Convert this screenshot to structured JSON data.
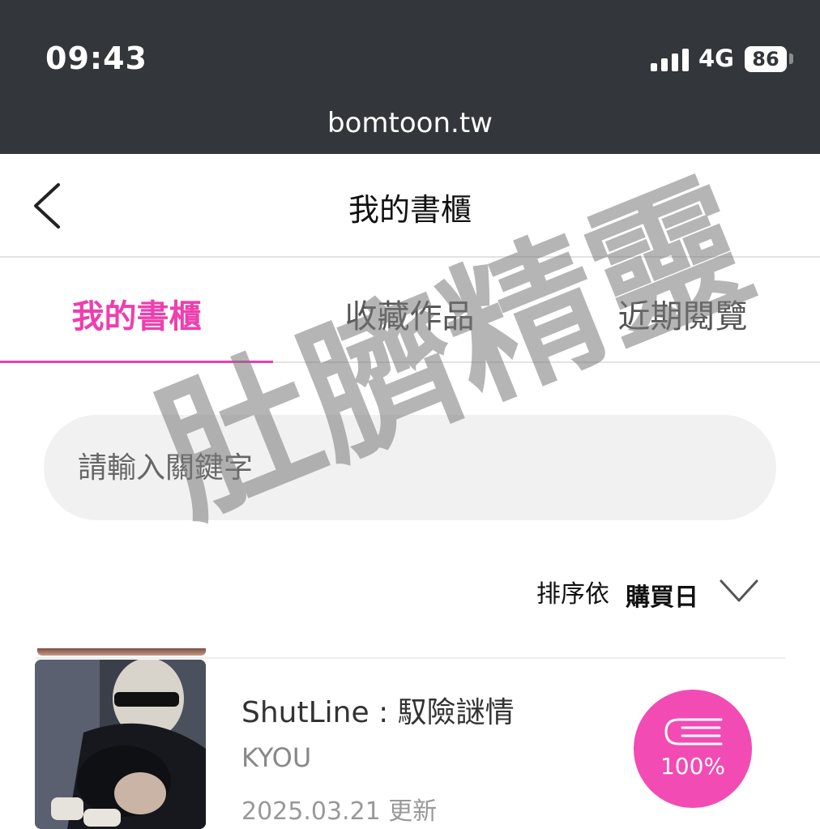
{
  "status_bar": {
    "time": "09:43",
    "network": "4G",
    "battery": "86"
  },
  "browser": {
    "url": "bomtoon.tw"
  },
  "header": {
    "title": "我的書櫃",
    "back_icon": "chevron-left-icon"
  },
  "tabs": [
    {
      "label": "我的書櫃",
      "active": true
    },
    {
      "label": "收藏作品",
      "active": false
    },
    {
      "label": "近期閱覽",
      "active": false
    }
  ],
  "search": {
    "placeholder": "請輸入關鍵字"
  },
  "sort": {
    "label": "排序依",
    "value": "購買日",
    "icon": "chevron-down-icon"
  },
  "books": [
    {
      "title": "ShutLine : 馭險謎情",
      "author": "KYOU",
      "updated": "2025.03.21 更新",
      "progress": "100%",
      "progress_value": 1.0,
      "progress_icon": "book-icon"
    }
  ],
  "watermark": "肚臍精靈",
  "colors": {
    "accent": "#ee3fae",
    "progress_badge": "#f24bb4",
    "status_bar": "#33363a"
  }
}
